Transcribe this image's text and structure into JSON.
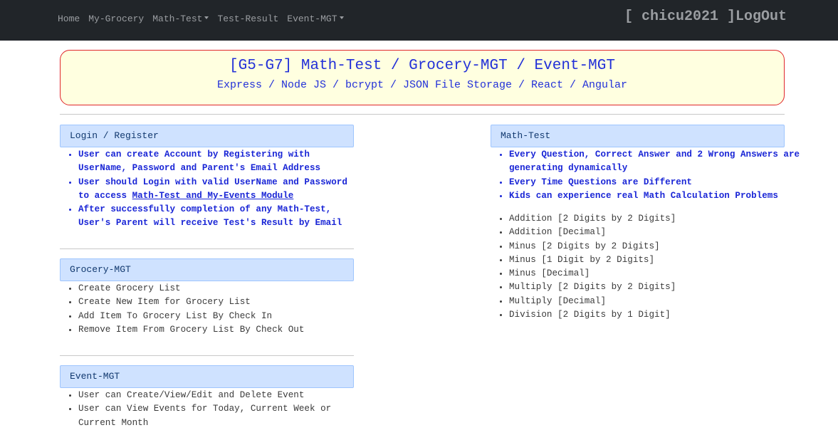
{
  "nav": {
    "home": "Home",
    "grocery": "My-Grocery",
    "math_test": "Math-Test",
    "test_result": "Test-Result",
    "event_mgt": "Event-MGT"
  },
  "user": {
    "display": "[ chicu2021 ]",
    "logout": "LogOut"
  },
  "banner": {
    "title": "[G5-G7] Math-Test / Grocery-MGT / Event-MGT",
    "subtitle": "Express / Node JS / bcrypt / JSON File Storage / React / Angular"
  },
  "login_section": {
    "header": "Login / Register",
    "items": [
      "User can create Account by Registering with UserName, Password and Parent's Email Address",
      "User should Login with valid UserName and Password to access ",
      "After successfully completion of any Math-Test, User's Parent will receive Test's Result by Email"
    ],
    "link_text": "Math-Test and My-Events Module"
  },
  "grocery_section": {
    "header": "Grocery-MGT",
    "items": [
      "Create Grocery List",
      "Create New Item for Grocery List",
      "Add Item To Grocery List By Check In",
      "Remove Item From Grocery List By Check Out"
    ]
  },
  "event_section": {
    "header": "Event-MGT",
    "items": [
      "User can Create/View/Edit and Delete Event",
      "User can View Events for Today, Current Week or Current Month"
    ]
  },
  "math_section": {
    "header": "Math-Test",
    "features": [
      "Every Question, Correct Answer and 2 Wrong Answers are generating dynamically",
      "Every Time Questions are Different",
      "Kids can experience real Math Calculation Problems"
    ],
    "topics": [
      "Addition [2 Digits by 2 Digits]",
      "Addition [Decimal]",
      "Minus [2 Digits by 2 Digits]",
      "Minus [1 Digit by 2 Digits]",
      "Minus [Decimal]",
      "Multiply [2 Digits by 2 Digits]",
      "Multiply [Decimal]",
      "Division [2 Digits by 1 Digit]"
    ]
  },
  "colors": {
    "navbar": "#212529",
    "banner_bg": "#ffffe0",
    "banner_border": "#e0262b",
    "banner_text": "#2230d8",
    "card_header_bg": "#cfe2ff",
    "feature_text": "#1a26d6"
  }
}
